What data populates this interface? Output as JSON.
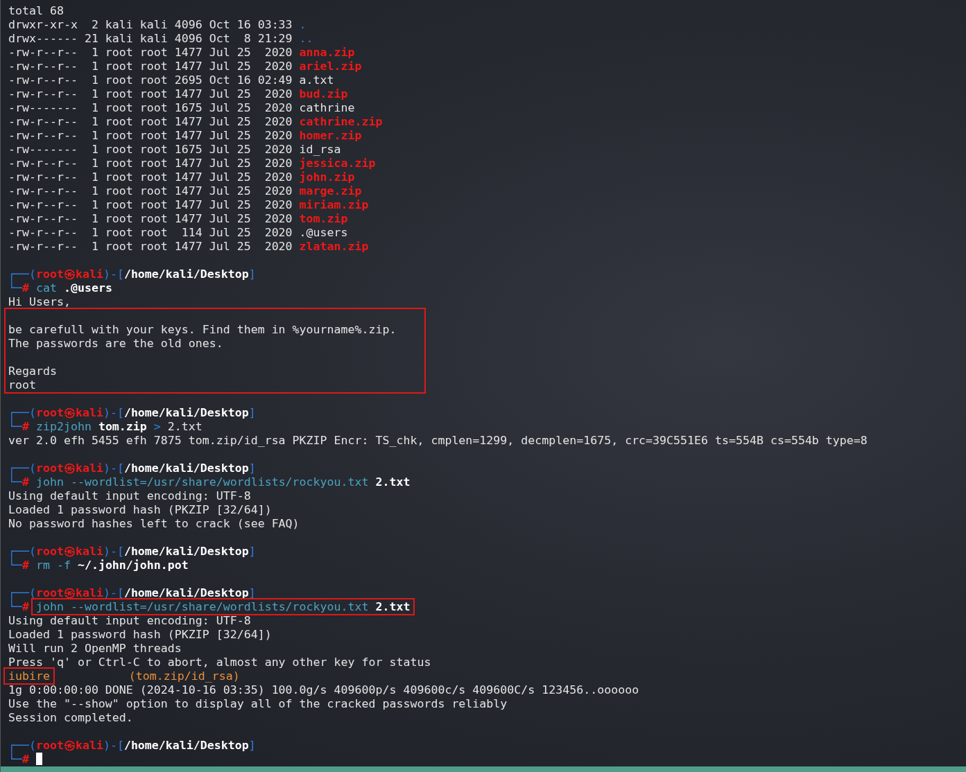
{
  "terminal": {
    "lines": [
      {
        "kind": "line",
        "segments": [
          {
            "text": "total 68",
            "kind": "plain",
            "boxed": false
          }
        ]
      },
      {
        "kind": "line",
        "segments": [
          {
            "text": "drwxr-xr-x  2 kali kali 4096 Oct 16 03:33 ",
            "kind": "plain",
            "boxed": false
          },
          {
            "text": ".",
            "kind": "dir",
            "boxed": false
          }
        ]
      },
      {
        "kind": "line",
        "segments": [
          {
            "text": "drwx------ 21 kali kali 4096 Oct  8 21:29 ",
            "kind": "plain",
            "boxed": false
          },
          {
            "text": "..",
            "kind": "dir",
            "boxed": false
          }
        ]
      },
      {
        "kind": "line",
        "segments": [
          {
            "text": "-rw-r--r--  1 root root 1477 Jul 25  2020 ",
            "kind": "plain",
            "boxed": false
          },
          {
            "text": "anna.zip",
            "kind": "archive",
            "boxed": false
          }
        ]
      },
      {
        "kind": "line",
        "segments": [
          {
            "text": "-rw-r--r--  1 root root 1477 Jul 25  2020 ",
            "kind": "plain",
            "boxed": false
          },
          {
            "text": "ariel.zip",
            "kind": "archive",
            "boxed": false
          }
        ]
      },
      {
        "kind": "line",
        "segments": [
          {
            "text": "-rw-r--r--  1 root root 2695 Oct 16 02:49 a.txt",
            "kind": "plain",
            "boxed": false
          }
        ]
      },
      {
        "kind": "line",
        "segments": [
          {
            "text": "-rw-r--r--  1 root root 1477 Jul 25  2020 ",
            "kind": "plain",
            "boxed": false
          },
          {
            "text": "bud.zip",
            "kind": "archive",
            "boxed": false
          }
        ]
      },
      {
        "kind": "line",
        "segments": [
          {
            "text": "-rw-------  1 root root 1675 Jul 25  2020 cathrine",
            "kind": "plain",
            "boxed": false
          }
        ]
      },
      {
        "kind": "line",
        "segments": [
          {
            "text": "-rw-r--r--  1 root root 1477 Jul 25  2020 ",
            "kind": "plain",
            "boxed": false
          },
          {
            "text": "cathrine.zip",
            "kind": "archive",
            "boxed": false
          }
        ]
      },
      {
        "kind": "line",
        "segments": [
          {
            "text": "-rw-r--r--  1 root root 1477 Jul 25  2020 ",
            "kind": "plain",
            "boxed": false
          },
          {
            "text": "homer.zip",
            "kind": "archive",
            "boxed": false
          }
        ]
      },
      {
        "kind": "line",
        "segments": [
          {
            "text": "-rw-------  1 root root 1675 Jul 25  2020 id_rsa",
            "kind": "plain",
            "boxed": false
          }
        ]
      },
      {
        "kind": "line",
        "segments": [
          {
            "text": "-rw-r--r--  1 root root 1477 Jul 25  2020 ",
            "kind": "plain",
            "boxed": false
          },
          {
            "text": "jessica.zip",
            "kind": "archive",
            "boxed": false
          }
        ]
      },
      {
        "kind": "line",
        "segments": [
          {
            "text": "-rw-r--r--  1 root root 1477 Jul 25  2020 ",
            "kind": "plain",
            "boxed": false
          },
          {
            "text": "john.zip",
            "kind": "archive",
            "boxed": false
          }
        ]
      },
      {
        "kind": "line",
        "segments": [
          {
            "text": "-rw-r--r--  1 root root 1477 Jul 25  2020 ",
            "kind": "plain",
            "boxed": false
          },
          {
            "text": "marge.zip",
            "kind": "archive",
            "boxed": false
          }
        ]
      },
      {
        "kind": "line",
        "segments": [
          {
            "text": "-rw-r--r--  1 root root 1477 Jul 25  2020 ",
            "kind": "plain",
            "boxed": false
          },
          {
            "text": "miriam.zip",
            "kind": "archive",
            "boxed": false
          }
        ]
      },
      {
        "kind": "line",
        "segments": [
          {
            "text": "-rw-r--r--  1 root root 1477 Jul 25  2020 ",
            "kind": "plain",
            "boxed": false
          },
          {
            "text": "tom.zip",
            "kind": "archive",
            "boxed": false
          }
        ]
      },
      {
        "kind": "line",
        "segments": [
          {
            "text": "-rw-r--r--  1 root root  114 Jul 25  2020 .@users",
            "kind": "plain",
            "boxed": false
          }
        ]
      },
      {
        "kind": "line",
        "segments": [
          {
            "text": "-rw-r--r--  1 root root 1477 Jul 25  2020 ",
            "kind": "plain",
            "boxed": false
          },
          {
            "text": "zlatan.zip",
            "kind": "archive",
            "boxed": false
          }
        ]
      },
      {
        "kind": "blank"
      },
      {
        "kind": "line",
        "segments": [
          {
            "text": "┌──(",
            "kind": "frame",
            "boxed": false
          },
          {
            "text": "root㉿kali",
            "kind": "host",
            "boxed": false
          },
          {
            "text": ")-[",
            "kind": "frame",
            "boxed": false
          },
          {
            "text": "/home/kali/Desktop",
            "kind": "path",
            "boxed": false
          },
          {
            "text": "]",
            "kind": "frame",
            "boxed": false
          }
        ]
      },
      {
        "kind": "line",
        "segments": [
          {
            "text": "└─",
            "kind": "frame",
            "boxed": false
          },
          {
            "text": "# ",
            "kind": "host",
            "boxed": false
          },
          {
            "text": "cat ",
            "kind": "command",
            "boxed": false
          },
          {
            "text": ".@users",
            "kind": "path",
            "boxed": false
          }
        ]
      },
      {
        "kind": "line",
        "segments": [
          {
            "text": "Hi Users,",
            "kind": "plain",
            "boxed": false
          }
        ]
      },
      {
        "kind": "box",
        "lines": [
          {
            "kind": "blank"
          },
          {
            "kind": "line",
            "segments": [
              {
                "text": "be carefull with your keys. Find them in %yourname%.zip.",
                "kind": "plain",
                "boxed": false
              }
            ]
          },
          {
            "kind": "line",
            "segments": [
              {
                "text": "The passwords are the old ones.",
                "kind": "plain",
                "boxed": false
              }
            ]
          },
          {
            "kind": "blank"
          },
          {
            "kind": "line",
            "segments": [
              {
                "text": "Regards",
                "kind": "plain",
                "boxed": false
              }
            ]
          },
          {
            "kind": "line",
            "segments": [
              {
                "text": "root",
                "kind": "plain",
                "boxed": false
              }
            ]
          }
        ]
      },
      {
        "kind": "blank"
      },
      {
        "kind": "line",
        "segments": [
          {
            "text": "┌──(",
            "kind": "frame",
            "boxed": false
          },
          {
            "text": "root㉿kali",
            "kind": "host",
            "boxed": false
          },
          {
            "text": ")-[",
            "kind": "frame",
            "boxed": false
          },
          {
            "text": "/home/kali/Desktop",
            "kind": "path",
            "boxed": false
          },
          {
            "text": "]",
            "kind": "frame",
            "boxed": false
          }
        ]
      },
      {
        "kind": "line",
        "segments": [
          {
            "text": "└─",
            "kind": "frame",
            "boxed": false
          },
          {
            "text": "# ",
            "kind": "host",
            "boxed": false
          },
          {
            "text": "zip2john ",
            "kind": "command",
            "boxed": false
          },
          {
            "text": "tom.zip",
            "kind": "path",
            "boxed": false
          },
          {
            "text": " > ",
            "kind": "frame",
            "boxed": false
          },
          {
            "text": "2.txt",
            "kind": "plain",
            "boxed": false
          }
        ]
      },
      {
        "kind": "line",
        "segments": [
          {
            "text": "ver 2.0 efh 5455 efh 7875 tom.zip/id_rsa PKZIP Encr: TS_chk, cmplen=1299, decmplen=1675, crc=39C551E6 ts=554B cs=554b type=8",
            "kind": "plain",
            "boxed": false
          }
        ]
      },
      {
        "kind": "blank"
      },
      {
        "kind": "line",
        "segments": [
          {
            "text": "┌──(",
            "kind": "frame",
            "boxed": false
          },
          {
            "text": "root㉿kali",
            "kind": "host",
            "boxed": false
          },
          {
            "text": ")-[",
            "kind": "frame",
            "boxed": false
          },
          {
            "text": "/home/kali/Desktop",
            "kind": "path",
            "boxed": false
          },
          {
            "text": "]",
            "kind": "frame",
            "boxed": false
          }
        ]
      },
      {
        "kind": "line",
        "segments": [
          {
            "text": "└─",
            "kind": "frame",
            "boxed": false
          },
          {
            "text": "# ",
            "kind": "host",
            "boxed": false
          },
          {
            "text": "john --wordlist=/usr/share/wordlists/rockyou.txt ",
            "kind": "command",
            "boxed": false
          },
          {
            "text": "2.txt",
            "kind": "path",
            "boxed": false
          }
        ]
      },
      {
        "kind": "line",
        "segments": [
          {
            "text": "Using default input encoding: UTF-8",
            "kind": "plain",
            "boxed": false
          }
        ]
      },
      {
        "kind": "line",
        "segments": [
          {
            "text": "Loaded 1 password hash (PKZIP [32/64])",
            "kind": "plain",
            "boxed": false
          }
        ]
      },
      {
        "kind": "line",
        "segments": [
          {
            "text": "No password hashes left to crack (see FAQ)",
            "kind": "plain",
            "boxed": false
          }
        ]
      },
      {
        "kind": "blank"
      },
      {
        "kind": "line",
        "segments": [
          {
            "text": "┌──(",
            "kind": "frame",
            "boxed": false
          },
          {
            "text": "root㉿kali",
            "kind": "host",
            "boxed": false
          },
          {
            "text": ")-[",
            "kind": "frame",
            "boxed": false
          },
          {
            "text": "/home/kali/Desktop",
            "kind": "path",
            "boxed": false
          },
          {
            "text": "]",
            "kind": "frame",
            "boxed": false
          }
        ]
      },
      {
        "kind": "line",
        "segments": [
          {
            "text": "└─",
            "kind": "frame",
            "boxed": false
          },
          {
            "text": "# ",
            "kind": "host",
            "boxed": false
          },
          {
            "text": "rm -f ",
            "kind": "command",
            "boxed": false
          },
          {
            "text": "~/.john/john.pot",
            "kind": "path",
            "boxed": false
          }
        ]
      },
      {
        "kind": "blank"
      },
      {
        "kind": "line",
        "segments": [
          {
            "text": "┌──(",
            "kind": "frame",
            "boxed": false
          },
          {
            "text": "root㉿kali",
            "kind": "host",
            "boxed": false
          },
          {
            "text": ")-[",
            "kind": "frame",
            "boxed": false
          },
          {
            "text": "/home/kali/Desktop",
            "kind": "path",
            "boxed": false
          },
          {
            "text": "]",
            "kind": "frame",
            "boxed": false
          }
        ]
      },
      {
        "kind": "line",
        "segments": [
          {
            "text": "└─",
            "kind": "frame",
            "boxed": false
          },
          {
            "text": "# ",
            "kind": "host",
            "boxed": false
          },
          {
            "text": "john --wordlist=/usr/share/wordlists/rockyou.txt ",
            "kind": "command",
            "boxed": true
          },
          {
            "text": "2.txt",
            "kind": "path",
            "boxed": true
          }
        ]
      },
      {
        "kind": "line",
        "segments": [
          {
            "text": "Using default input encoding: UTF-8",
            "kind": "plain",
            "boxed": false
          }
        ]
      },
      {
        "kind": "line",
        "segments": [
          {
            "text": "Loaded 1 password hash (PKZIP [32/64])",
            "kind": "plain",
            "boxed": false
          }
        ]
      },
      {
        "kind": "line",
        "segments": [
          {
            "text": "Will run 2 OpenMP threads",
            "kind": "plain",
            "boxed": false
          }
        ]
      },
      {
        "kind": "line",
        "segments": [
          {
            "text": "Press 'q' or Ctrl-C to abort, almost any other key for status",
            "kind": "plain",
            "boxed": false
          }
        ]
      },
      {
        "kind": "line",
        "segments": [
          {
            "text": "iubire",
            "kind": "cracked",
            "boxed": true
          },
          {
            "text": "           (tom.zip/id_rsa)",
            "kind": "cracked",
            "boxed": false
          }
        ]
      },
      {
        "kind": "line",
        "segments": [
          {
            "text": "1g 0:00:00:00 DONE (2024-10-16 03:35) 100.0g/s 409600p/s 409600c/s 409600C/s 123456..oooooo",
            "kind": "plain",
            "boxed": false
          }
        ]
      },
      {
        "kind": "line",
        "segments": [
          {
            "text": "Use the \"--show\" option to display all of the cracked passwords reliably",
            "kind": "plain",
            "boxed": false
          }
        ]
      },
      {
        "kind": "line",
        "segments": [
          {
            "text": "Session completed.",
            "kind": "plain",
            "boxed": false
          }
        ]
      },
      {
        "kind": "blank"
      },
      {
        "kind": "line",
        "segments": [
          {
            "text": "┌──(",
            "kind": "frame",
            "boxed": false
          },
          {
            "text": "root㉿kali",
            "kind": "host",
            "boxed": false
          },
          {
            "text": ")-[",
            "kind": "frame",
            "boxed": false
          },
          {
            "text": "/home/kali/Desktop",
            "kind": "path",
            "boxed": false
          },
          {
            "text": "]",
            "kind": "frame",
            "boxed": false
          }
        ]
      },
      {
        "kind": "line",
        "cursor": true,
        "segments": [
          {
            "text": "└─",
            "kind": "frame",
            "boxed": false
          },
          {
            "text": "# ",
            "kind": "host",
            "boxed": false
          }
        ]
      }
    ]
  }
}
